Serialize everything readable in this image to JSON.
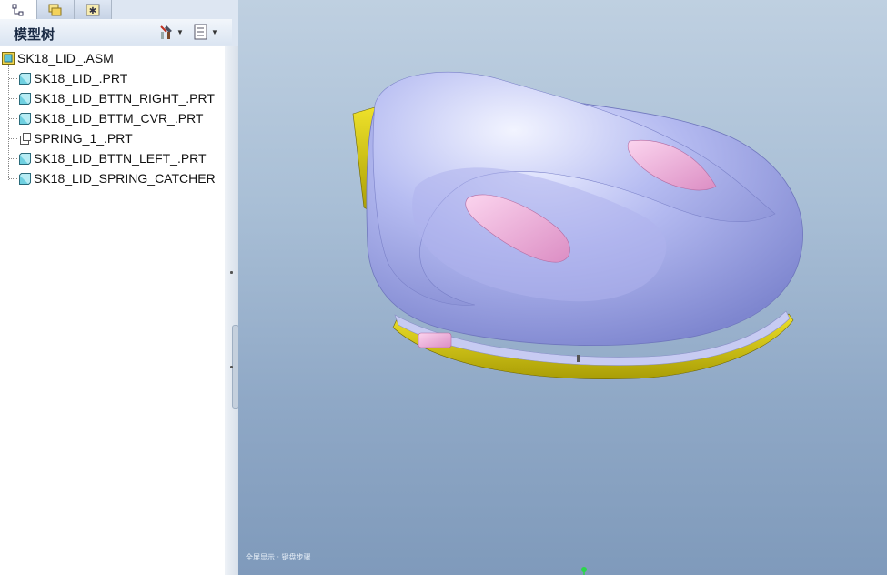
{
  "panel_tabs": [
    {
      "icon": "model-tree-icon",
      "active": true
    },
    {
      "icon": "folder-browser-icon",
      "active": false
    },
    {
      "icon": "favorites-icon",
      "active": false
    }
  ],
  "model_tree": {
    "title": "模型树",
    "settings_icon": "tree-settings-icon",
    "show_icon": "tree-show-icon",
    "root": {
      "label": "SK18_LID_.ASM",
      "icon": "assembly-icon"
    },
    "items": [
      {
        "label": "SK18_LID_.PRT",
        "icon": "part-icon"
      },
      {
        "label": "SK18_LID_BTTN_RIGHT_.PRT",
        "icon": "part-icon"
      },
      {
        "label": "SK18_LID_BTTM_CVR_.PRT",
        "icon": "part-icon"
      },
      {
        "label": "SPRING_1_.PRT",
        "icon": "flexible-part-icon"
      },
      {
        "label": "SK18_LID_BTTN_LEFT_.PRT",
        "icon": "part-icon"
      },
      {
        "label": "SK18_LID_SPRING_CATCHER",
        "icon": "part-icon"
      }
    ]
  },
  "viewport": {
    "status_note": "全屏显示 · 键盘步骤",
    "model_colors": {
      "body": "#aab0ee",
      "base": "#d9d10a",
      "button": "#f0aed8"
    }
  }
}
